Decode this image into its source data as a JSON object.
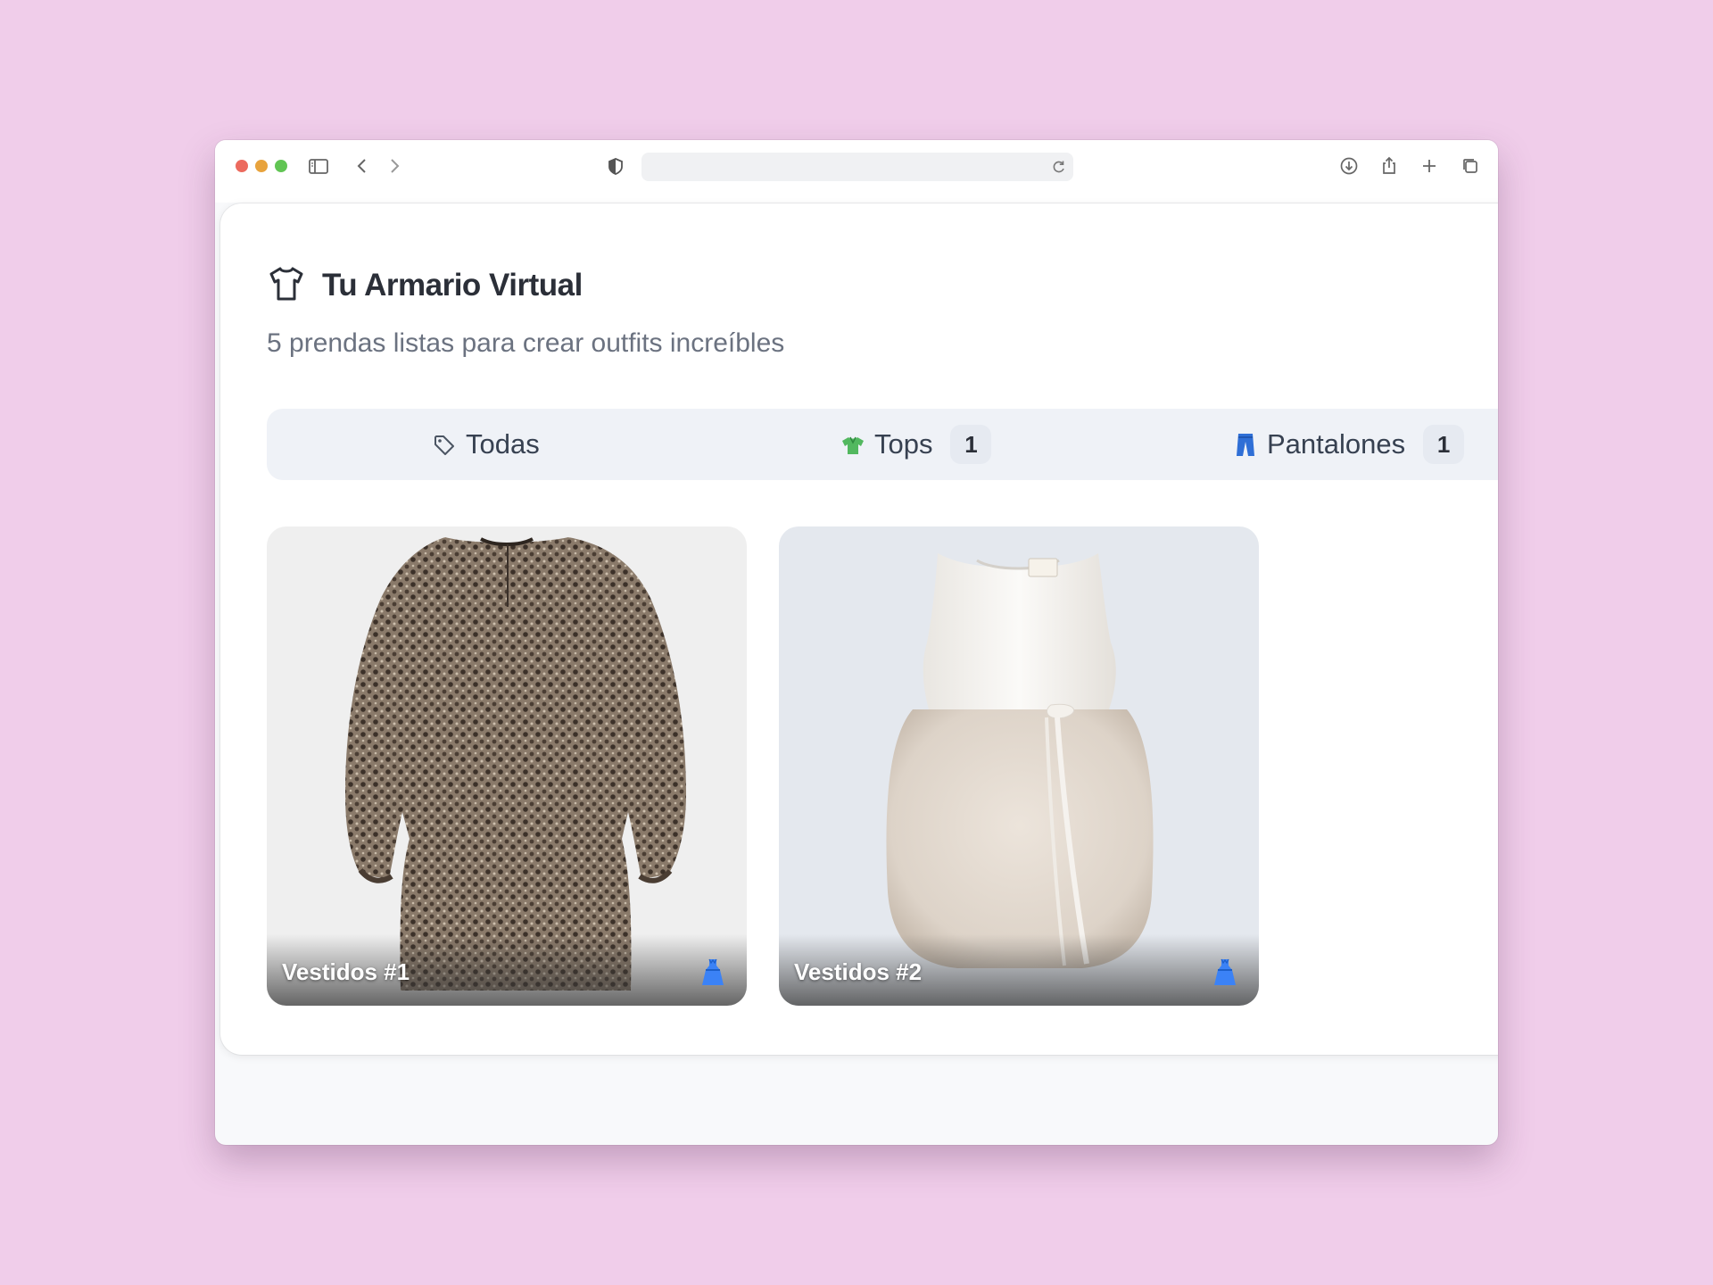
{
  "browser": {
    "address_value": "",
    "icons": [
      "sidebar-icon",
      "back-icon",
      "forward-icon",
      "shield-icon",
      "reload-icon",
      "download-icon",
      "share-icon",
      "new-tab-icon",
      "tabs-overview-icon"
    ]
  },
  "header": {
    "title": "Tu Armario Virtual",
    "subtitle": "5 prendas listas para crear outfits increíbles",
    "icon": "tshirt-icon"
  },
  "tabs": [
    {
      "label": "Todas",
      "icon": "tag-icon",
      "count": ""
    },
    {
      "label": "Tops",
      "icon": "green-shirt-icon",
      "count": "1"
    },
    {
      "label": "Pantalones",
      "icon": "jeans-icon",
      "count": "1"
    }
  ],
  "items": [
    {
      "label": "Vestidos #1",
      "badge_icon": "dress-icon"
    },
    {
      "label": "Vestidos #2",
      "badge_icon": "dress-icon"
    }
  ],
  "colors": {
    "background": "#f0cdea",
    "card": "#ffffff",
    "tabs_bar": "#eff2f7",
    "title": "#2b2f38",
    "subtitle": "#6b7280",
    "badge_blue": "#3b82f6"
  }
}
